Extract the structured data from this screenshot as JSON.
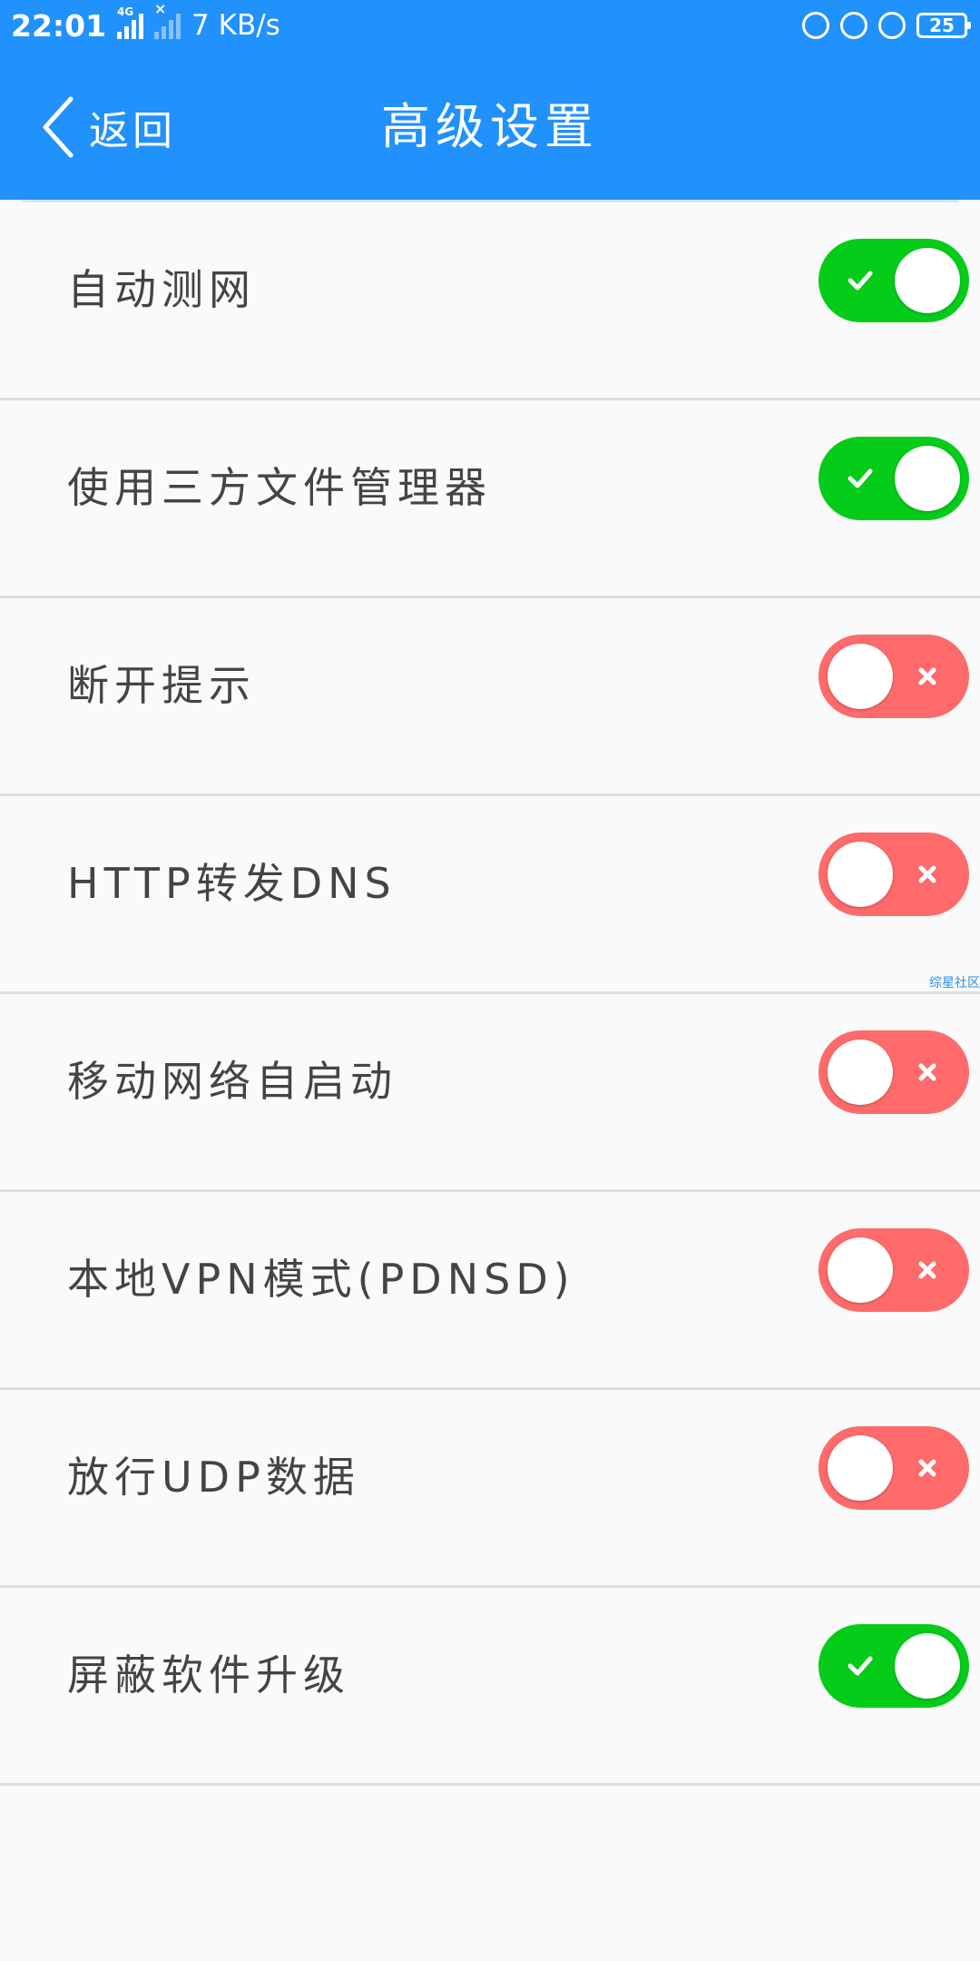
{
  "status_bar": {
    "time": "22:01",
    "network_type": "4G",
    "speed": "7 KB/s",
    "battery": "25"
  },
  "header": {
    "back_label": "返回",
    "title": "高级设置"
  },
  "settings": [
    {
      "label": "自动测网",
      "enabled": true
    },
    {
      "label": "使用三方文件管理器",
      "enabled": true
    },
    {
      "label": "断开提示",
      "enabled": false
    },
    {
      "label": "HTTP转发DNS",
      "enabled": false
    },
    {
      "label": "移动网络自启动",
      "enabled": false
    },
    {
      "label": "本地VPN模式(PDNSD)",
      "enabled": false
    },
    {
      "label": "放行UDP数据",
      "enabled": false
    },
    {
      "label": "屏蔽软件升级",
      "enabled": true
    }
  ],
  "watermark": "综星社区",
  "colors": {
    "header": "#2191fb",
    "toggle_on": "#05cc19",
    "toggle_off": "#ff6a6a",
    "background": "#fafafa"
  }
}
